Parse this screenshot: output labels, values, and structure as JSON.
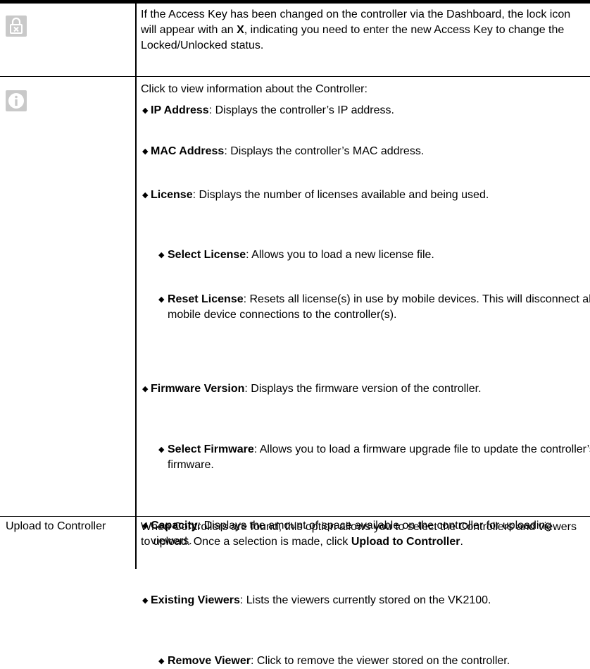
{
  "row1": {
    "icon": "lock-x-icon",
    "text_pre": "If the Access Key has been changed on the controller via the Dashboard, the lock icon will appear with an ",
    "text_bold": "X",
    "text_post": ", indicating you need to enter the new Access Key to change the Locked/Unlocked status."
  },
  "row2": {
    "icon": "info-icon",
    "intro": "Click to view information about the Controller:",
    "ip": {
      "bold": "IP Address",
      "text": ": Displays the controller’s IP address."
    },
    "mac": {
      "bold": "MAC Address",
      "text": ": Displays the controller’s MAC address."
    },
    "license": {
      "bold": "License",
      "text": ": Displays the number of licenses available and being used."
    },
    "select_license": {
      "bold": "Select License",
      "text": ": Allows you to load a new license file."
    },
    "reset_license": {
      "bold": "Reset License",
      "text": ": Resets all license(s) in use by mobile devices. This will disconnect all mobile device connections to the controller(s)."
    },
    "firmware": {
      "bold": "Firmware Version",
      "text": ": Displays the firmware version of the controller."
    },
    "select_firmware": {
      "bold": "Select Firmware",
      "text": ": Allows you to load a firmware upgrade file to update the controller’s firmware."
    },
    "capacity": {
      "bold": "Capacity",
      "text": ": Displays the amount of space available on the controller for uploading viewers."
    },
    "existing": {
      "bold": "Existing Viewers",
      "text": ": Lists the viewers currently stored on the VK2100."
    },
    "remove": {
      "bold": "Remove Viewer",
      "text": ": Click to remove the viewer stored on the controller."
    }
  },
  "row3": {
    "label": "Upload to Controller",
    "text_pre": "When Controllers are found, this option allows you to select the Controllers and viewers to upload. Once a selection is made, click ",
    "text_bold": "Upload to Controller",
    "text_post": "."
  }
}
